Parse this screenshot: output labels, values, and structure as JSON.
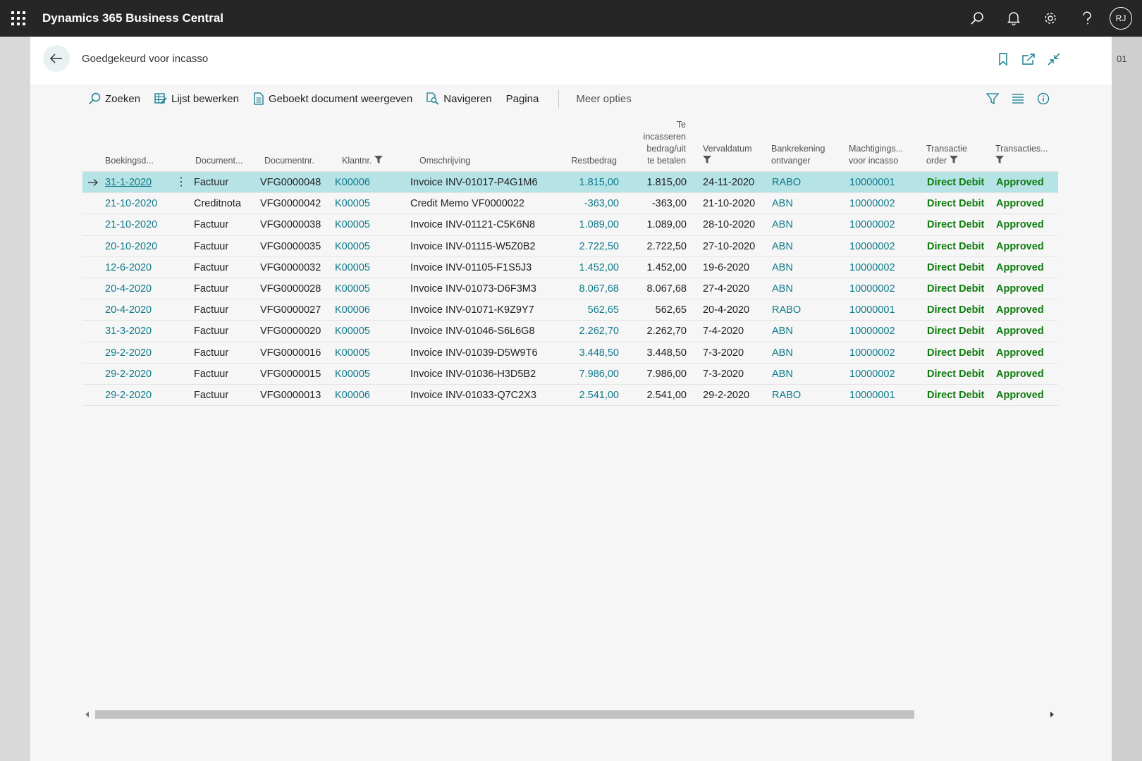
{
  "app": {
    "title": "Dynamics 365 Business Central",
    "user_initials": "RJ",
    "side_label": "01"
  },
  "page": {
    "title": "Goedgekeurd voor incasso"
  },
  "actions": {
    "search": "Zoeken",
    "edit_list": "Lijst bewerken",
    "show_posted": "Geboekt document weergeven",
    "navigate": "Navigeren",
    "page": "Pagina",
    "more": "Meer opties"
  },
  "columns": {
    "posting_date": "Boekingsd...",
    "document_type": "Document...",
    "document_no": "Documentnr.",
    "customer_no": "Klantnr.",
    "description": "Omschrijving",
    "remaining_amount": "Restbedrag",
    "collect_amount_1": "Te",
    "collect_amount_2": "incasseren",
    "collect_amount_3": "bedrag/uit",
    "collect_amount_4": "te betalen",
    "due_date": "Vervaldatum",
    "bank_account_1": "Bankrekening",
    "bank_account_2": "ontvanger",
    "mandate_1": "Machtigings...",
    "mandate_2": "voor incasso",
    "transaction_order_1": "Transactie",
    "transaction_order_2": "order",
    "transactions": "Transacties..."
  },
  "rows": [
    {
      "date": "31-1-2020",
      "type": "Factuur",
      "doc": "VFG0000048",
      "cust": "K00006",
      "desc": "Invoice INV-01017-P4G1M6",
      "rest": "1.815,00",
      "amount": "1.815,00",
      "due": "24-11-2020",
      "bank": "RABO",
      "mandate": "10000001",
      "order": "Direct Debit",
      "status": "Approved"
    },
    {
      "date": "21-10-2020",
      "type": "Creditnota",
      "doc": "VFG0000042",
      "cust": "K00005",
      "desc": "Credit Memo VF0000022",
      "rest": "-363,00",
      "amount": "-363,00",
      "due": "21-10-2020",
      "bank": "ABN",
      "mandate": "10000002",
      "order": "Direct Debit",
      "status": "Approved"
    },
    {
      "date": "21-10-2020",
      "type": "Factuur",
      "doc": "VFG0000038",
      "cust": "K00005",
      "desc": "Invoice INV-01121-C5K6N8",
      "rest": "1.089,00",
      "amount": "1.089,00",
      "due": "28-10-2020",
      "bank": "ABN",
      "mandate": "10000002",
      "order": "Direct Debit",
      "status": "Approved"
    },
    {
      "date": "20-10-2020",
      "type": "Factuur",
      "doc": "VFG0000035",
      "cust": "K00005",
      "desc": "Invoice INV-01115-W5Z0B2",
      "rest": "2.722,50",
      "amount": "2.722,50",
      "due": "27-10-2020",
      "bank": "ABN",
      "mandate": "10000002",
      "order": "Direct Debit",
      "status": "Approved"
    },
    {
      "date": "12-6-2020",
      "type": "Factuur",
      "doc": "VFG0000032",
      "cust": "K00005",
      "desc": "Invoice INV-01105-F1S5J3",
      "rest": "1.452,00",
      "amount": "1.452,00",
      "due": "19-6-2020",
      "bank": "ABN",
      "mandate": "10000002",
      "order": "Direct Debit",
      "status": "Approved"
    },
    {
      "date": "20-4-2020",
      "type": "Factuur",
      "doc": "VFG0000028",
      "cust": "K00005",
      "desc": "Invoice INV-01073-D6F3M3",
      "rest": "8.067,68",
      "amount": "8.067,68",
      "due": "27-4-2020",
      "bank": "ABN",
      "mandate": "10000002",
      "order": "Direct Debit",
      "status": "Approved"
    },
    {
      "date": "20-4-2020",
      "type": "Factuur",
      "doc": "VFG0000027",
      "cust": "K00006",
      "desc": "Invoice INV-01071-K9Z9Y7",
      "rest": "562,65",
      "amount": "562,65",
      "due": "20-4-2020",
      "bank": "RABO",
      "mandate": "10000001",
      "order": "Direct Debit",
      "status": "Approved"
    },
    {
      "date": "31-3-2020",
      "type": "Factuur",
      "doc": "VFG0000020",
      "cust": "K00005",
      "desc": "Invoice INV-01046-S6L6G8",
      "rest": "2.262,70",
      "amount": "2.262,70",
      "due": "7-4-2020",
      "bank": "ABN",
      "mandate": "10000002",
      "order": "Direct Debit",
      "status": "Approved"
    },
    {
      "date": "29-2-2020",
      "type": "Factuur",
      "doc": "VFG0000016",
      "cust": "K00005",
      "desc": "Invoice INV-01039-D5W9T6",
      "rest": "3.448,50",
      "amount": "3.448,50",
      "due": "7-3-2020",
      "bank": "ABN",
      "mandate": "10000002",
      "order": "Direct Debit",
      "status": "Approved"
    },
    {
      "date": "29-2-2020",
      "type": "Factuur",
      "doc": "VFG0000015",
      "cust": "K00005",
      "desc": "Invoice INV-01036-H3D5B2",
      "rest": "7.986,00",
      "amount": "7.986,00",
      "due": "7-3-2020",
      "bank": "ABN",
      "mandate": "10000002",
      "order": "Direct Debit",
      "status": "Approved"
    },
    {
      "date": "29-2-2020",
      "type": "Factuur",
      "doc": "VFG0000013",
      "cust": "K00006",
      "desc": "Invoice INV-01033-Q7C2X3",
      "rest": "2.541,00",
      "amount": "2.541,00",
      "due": "29-2-2020",
      "bank": "RABO",
      "mandate": "10000001",
      "order": "Direct Debit",
      "status": "Approved"
    }
  ],
  "selected_row": 0,
  "colors": {
    "topbar": "#262626",
    "link": "#0f7a8a",
    "selected_row": "#b5e3e6",
    "status_green": "#107c10"
  },
  "icons": [
    "waffle-icon",
    "search-icon",
    "bell-icon",
    "gear-icon",
    "help-icon",
    "back-arrow-icon",
    "bookmark-icon",
    "share-icon",
    "collapse-icon",
    "edit-list-icon",
    "document-icon",
    "navigate-icon",
    "filter-icon",
    "list-view-icon",
    "info-icon",
    "row-arrow-icon"
  ]
}
